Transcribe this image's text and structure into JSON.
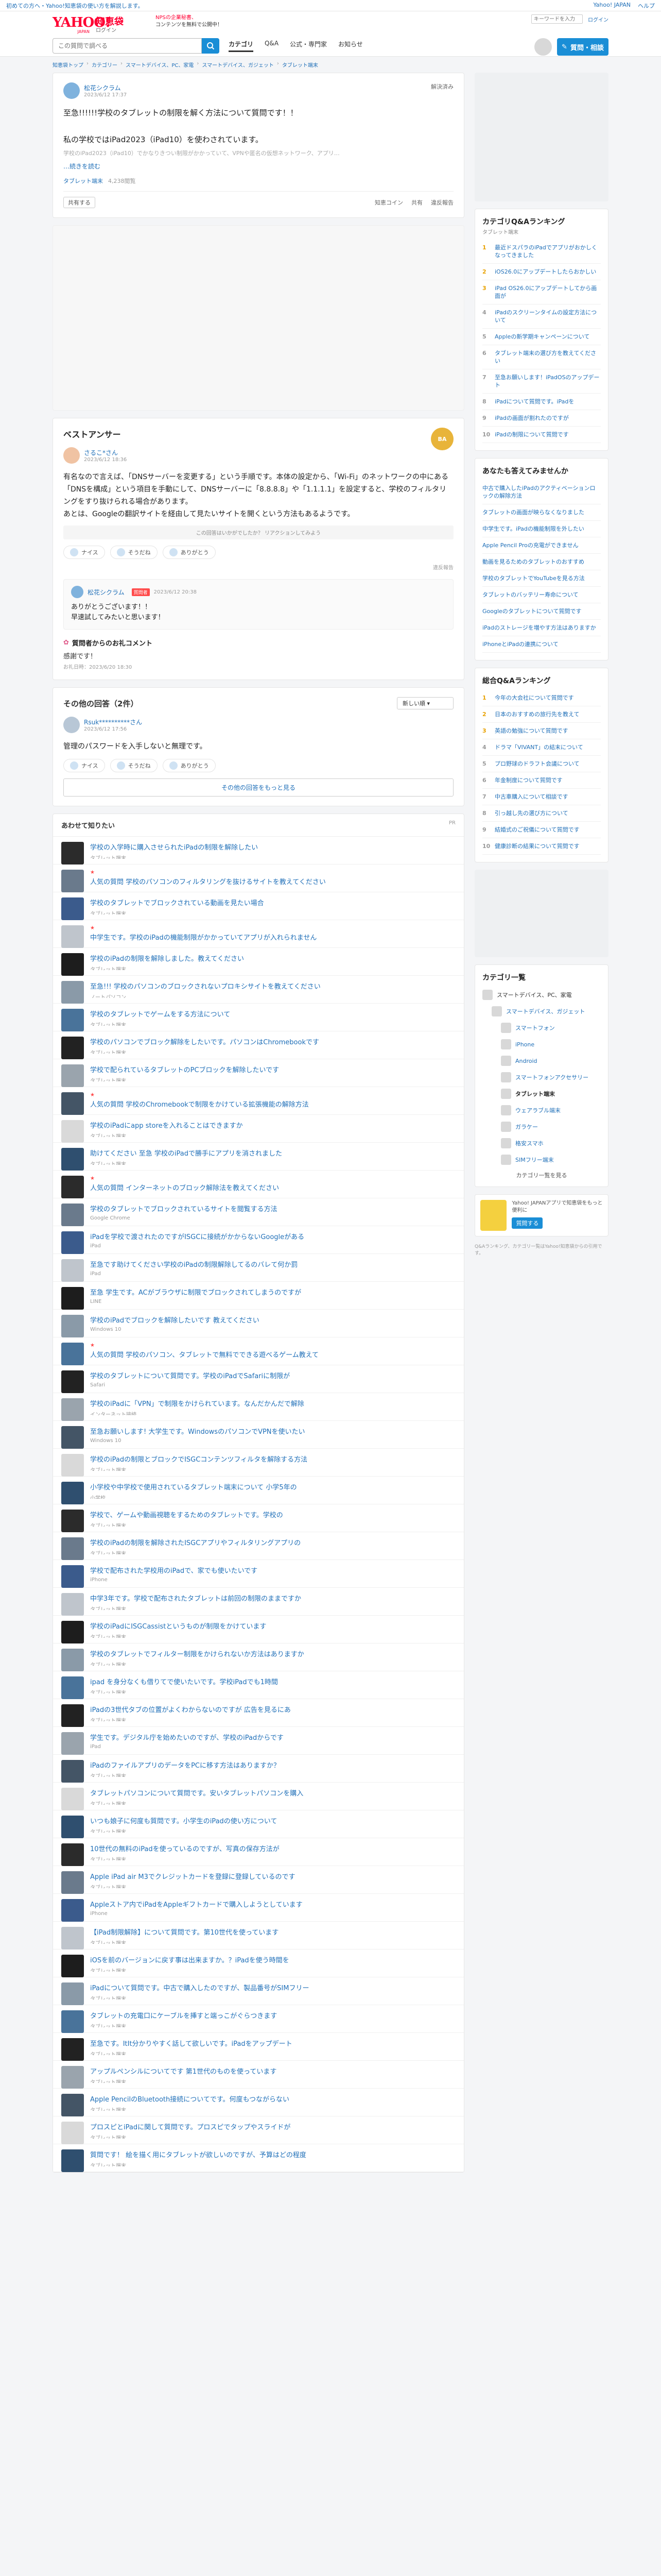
{
  "topline": {
    "left": "初めての方へ・Yahoo!知恵袋の使い方を解説します。",
    "links": [
      "Yahoo! JAPAN",
      "ヘルプ"
    ]
  },
  "header": {
    "logo": "YAHOO!",
    "logo_sub": "JAPAN",
    "brand": "知恵袋",
    "brand_sub": "ログイン",
    "promo_1": "NPSの企業秘書、",
    "promo_2": "コンテンツを無料で公開中！",
    "mini_search": "キーワードを入力",
    "login": "ログイン",
    "search_placeholder": "この質問で調べる",
    "nav": [
      "カテゴリ",
      "Q&A",
      "公式・専門家",
      "お知らせ"
    ],
    "ask_label": "質問・相談"
  },
  "breadcrumbs": [
    "知恵袋トップ",
    "カテゴリー",
    "スマートデバイス、PC、家電",
    "スマートデバイス、ガジェット",
    "タブレット端末"
  ],
  "question": {
    "user": "松花シクラム",
    "date": "2023/6/12 17:37",
    "status": "解決済み",
    "text": "至急!!!!!!学校のタブレットの制限を解く方法について質問です！！\n\n私の学校ではiPad2023（iPad10）を使わされています。",
    "hint": "学校のiPad2023（iPad10）でかなりきつい制限がかかっていて、VPNや匿名の仮想ネットワーク、アプリ…",
    "more": "…続きを読む",
    "tags": [
      "タブレット端末",
      "4,238閲覧"
    ],
    "share_label": "共有する",
    "actions": [
      "知恵コイン",
      "共有",
      "違反報告"
    ]
  },
  "best": {
    "title": "ベストアンサー",
    "medal": "BA",
    "user": "さるこ*さん",
    "date": "2023/6/12 18:36",
    "text": "有名なので言えば、「DNSサーバーを変更する」という手順です。本体の設定から、「Wi-Fi」のネットワークの中にある「DNSを構成」という項目を手動にして、DNSサーバーに「8.8.8.8」や「1.1.1.1」を設定すると、学校のフィルタリングをすり抜けられる場合があります。\nあとは、Googleの翻訳サイトを経由して見たいサイトを開くという方法もあるようです。",
    "notice": "この回答はいかがでしたか？ リアクションしてみよう",
    "reactions": [
      "ナイス",
      "そうだね",
      "ありがとう"
    ],
    "report": "違反報告",
    "reply_user": "松花シクラム",
    "reply_tag": "質問者",
    "reply_date": "2023/6/12 20:38",
    "reply_text": "ありがとうございます！！\n早速試してみたいと思います！",
    "thanks_title": "質問者からのお礼コメント",
    "thanks_text": "感謝です！",
    "thanks_date": "お礼日時：2023/6/20 18:30"
  },
  "others": {
    "title": "その他の回答（2件）",
    "sort": "新しい順",
    "user": "Rsuk**********さん",
    "date": "2023/6/12 17:56",
    "text": "管理のパスワードを入手しないと無理です。",
    "reactions": [
      "ナイス",
      "そうだね",
      "ありがとう"
    ],
    "more": "その他の回答をもっと見る"
  },
  "rec": {
    "title": "あわせて知りたい",
    "pr": "PR",
    "items": [
      {
        "t": "学校の入学時に購入させられたiPadの制限を解除したい",
        "c": "タブレット端末",
        "pr": false
      },
      {
        "t": "人気の質問 学校のパソコンのフィルタリングを抜けるサイトを教えてください",
        "c": "スマートデバイス、PC、家電",
        "pr": true
      },
      {
        "t": "学校のタブレットでブロックされている動画を見たい場合",
        "c": "タブレット端末",
        "pr": false
      },
      {
        "t": "中学生です。学校のiPadの機能制限がかかっていてアプリが入れられません",
        "c": "タブレット端末",
        "pr": true
      },
      {
        "t": "学校のiPadの制限を解除しました。教えてください",
        "c": "タブレット端末",
        "pr": false
      },
      {
        "t": "至急!!! 学校のパソコンのブロックされないプロキシサイトを教えてください",
        "c": "ノートパソコン",
        "pr": false
      },
      {
        "t": "学校のタブレットでゲームをする方法について",
        "c": "タブレット端末",
        "pr": false
      },
      {
        "t": "学校のパソコンでブロック解除をしたいです。パソコンはChromebookです",
        "c": "タブレット端末",
        "pr": false
      },
      {
        "t": "学校で配られているタブレットのPCブロックを解除したいです",
        "c": "タブレット端末",
        "pr": false
      },
      {
        "t": "人気の質問 学校のChromebookで制限をかけている拡張機能の解除方法",
        "c": "Google Chrome",
        "pr": true
      },
      {
        "t": "学校のiPadにapp storeを入れることはできますか",
        "c": "タブレット端末",
        "pr": false
      },
      {
        "t": "助けてください 至急 学校のiPadで勝手にアプリを消されました",
        "c": "タブレット端末",
        "pr": false
      },
      {
        "t": "人気の質問 インターネットのブロック解除法を教えてください",
        "c": "インターネットサービス",
        "pr": true
      },
      {
        "t": "学校のタブレットでブロックされているサイトを閲覧する方法",
        "c": "Google Chrome",
        "pr": false
      },
      {
        "t": "iPadを学校で渡されたのですがISGCに接続がかからないGoogleがある",
        "c": "iPad",
        "pr": false
      },
      {
        "t": "至急です助けてください学校のiPadの制限解除してるのバレて何か罰",
        "c": "iPad",
        "pr": false
      },
      {
        "t": "至急 学生です。ACがブラウザに制限でブロックされてしまうのですが",
        "c": "LINE",
        "pr": false
      },
      {
        "t": "学校のiPadでブロックを解除したいです 教えてください",
        "c": "Windows 10",
        "pr": false
      },
      {
        "t": "人気の質問 学校のパソコン、タブレットで無料でできる遊べるゲーム教えて",
        "c": "タブレット端末",
        "pr": true
      },
      {
        "t": "学校のタブレットについて質問です。学校のiPadでSafariに制限が",
        "c": "Safari",
        "pr": false
      },
      {
        "t": "学校のiPadに「VPN」で制限をかけられています。なんだかんだで解除",
        "c": "インターネット接続",
        "pr": false
      },
      {
        "t": "至急お願いします! 大学生です。WindowsのパソコンでVPNを使いたい",
        "c": "Windows 10",
        "pr": false
      },
      {
        "t": "学校のiPadの制限とブロックでISGCコンテンツフィルタを解除する方法",
        "c": "タブレット端末",
        "pr": false
      },
      {
        "t": "小学校や中学校で使用されているタブレット端末について 小学5年の",
        "c": "小学校",
        "pr": false
      },
      {
        "t": "学校で、ゲームや動画視聴をするためのタブレットです。学校の",
        "c": "タブレット端末",
        "pr": false
      },
      {
        "t": "学校のiPadの制限を解除されたISGCアプリやフィルタリングアプリの",
        "c": "タブレット端末",
        "pr": false
      },
      {
        "t": "学校で配布された学校用のiPadで、家でも使いたいです",
        "c": "iPhone",
        "pr": false
      },
      {
        "t": "中学3年です。学校で配布されたタブレットは前回の制限のままですか",
        "c": "タブレット端末",
        "pr": false
      },
      {
        "t": "学校のiPadにISGCassistというものが制限をかけています",
        "c": "タブレット端末",
        "pr": false
      },
      {
        "t": "学校のタブレットでフィルター制限をかけられないか方法はありますか",
        "c": "タブレット端末",
        "pr": false
      },
      {
        "t": "ipad を身分なくも借りてで使いたいです。学校iPadでも1時間",
        "c": "タブレット端末",
        "pr": false
      },
      {
        "t": "iPadの3世代タブの位置がよくわからないのですが 広告を見るにあ",
        "c": "タブレット端末",
        "pr": false
      },
      {
        "t": "学生です。デジタル庁を始めたいのですが、学校のiPadからです",
        "c": "iPad",
        "pr": false
      },
      {
        "t": "iPadのファイルアプリのデータをPCに移す方法はありますか？",
        "c": "タブレット端末",
        "pr": false
      },
      {
        "t": "タブレットパソコンについて質問です。安いタブレットパソコンを購入",
        "c": "タブレット端末",
        "pr": false
      },
      {
        "t": "いつも娘子に何度も質問です。小学生のiPadの使い方について",
        "c": "タブレット端末",
        "pr": false
      },
      {
        "t": "10世代の無料のiPadを使っているのですが、写真の保存方法が",
        "c": "タブレット端末",
        "pr": false
      },
      {
        "t": "Apple iPad air M3でクレジットカードを登録に登録しているのです",
        "c": "タブレット端末",
        "pr": false
      },
      {
        "t": "Appleストア内でiPadをAppleギフトカードで購入しようとしています",
        "c": "iPhone",
        "pr": false
      },
      {
        "t": "【iPad制限解除】について質問です。第10世代を使っています",
        "c": "タブレット端末",
        "pr": false
      },
      {
        "t": "iOSを前のバージョンに戻す事は出来ますか。？iPadを使う時間を",
        "c": "タブレット端末",
        "pr": false
      },
      {
        "t": "iPadについて質問です。中古で購入したのですが、製品番号がSIMフリー",
        "c": "タブレット端末",
        "pr": false
      },
      {
        "t": "タブレットの充電口にケーブルを挿すと端っこがぐらつきます",
        "c": "タブレット端末",
        "pr": false
      },
      {
        "t": "至急です。ItIt分かりやすく話して欲しいです。iPadをアップデート",
        "c": "タブレット端末",
        "pr": false
      },
      {
        "t": "アップルペンシルについてです 第1世代のものを使っています",
        "c": "タブレット端末",
        "pr": false
      },
      {
        "t": "Apple PencilのBluetooth接続についてです。何度もつながらない",
        "c": "タブレット端末",
        "pr": false
      },
      {
        "t": "プロスピとiPadに関して質問です。プロスピでタップやスライドが",
        "c": "タブレット端末",
        "pr": false
      },
      {
        "t": "質問です！ 絵を描く用にタブレットが欲しいのですが、予算はどの程度",
        "c": "タブレット端末",
        "pr": false
      }
    ]
  },
  "side": {
    "rank_title": "カテゴリQ&Aランキング",
    "rank_sub": "タブレット端末",
    "ranks": [
      "最近ドスパラのiPadでアプリがおかしくなってきました",
      "iOS26.0にアップデートしたらおかしい",
      "iPad OS26.0にアップデートしてから画面が",
      "iPadのスクリーンタイムの設定方法について",
      "Appleの新学期キャンペーンについて",
      "タブレット端末の選び方を教えてください",
      "至急お願いします！iPadOSのアップデート",
      "iPadについて質問です。iPadを",
      "iPadの画面が割れたのですが",
      "iPadの制限について質問です"
    ],
    "recent_title": "あなたも答えてみませんか",
    "recent": [
      "中古で購入したiPadのアクティベーションロックの解除方法",
      "タブレットの画面が映らなくなりました",
      "中学生です。iPadの機能制限を外したい",
      "Apple Pencil Proの充電ができません",
      "動画を見るためのタブレットのおすすめ",
      "学校のタブレットでYouTubeを見る方法",
      "タブレットのバッテリー寿命について",
      "Googleのタブレットについて質問です",
      "iPadのストレージを増やす方法はありますか",
      "iPhoneとiPadの連携について"
    ],
    "total_title": "総合Q&Aランキング",
    "total": [
      "今年の大会社について質問です",
      "日本のおすすめの旅行先を教えて",
      "英語の勉強について質問です",
      "ドラマ「VIVANT」の結末について",
      "プロ野球のドラフト会議について",
      "年金制度について質問です",
      "中古車購入について相談です",
      "引っ越し先の選び方について",
      "結婚式のご祝儀について質問です",
      "健康診断の結果について質問です"
    ],
    "cat_title": "カテゴリ一覧",
    "cats": [
      {
        "n": "スマートデバイス、PC、家電",
        "l": 0
      },
      {
        "n": "スマートデバイス、ガジェット",
        "l": 1
      },
      {
        "n": "スマートフォン",
        "l": 2
      },
      {
        "n": "iPhone",
        "l": 2
      },
      {
        "n": "Android",
        "l": 2
      },
      {
        "n": "スマートフォンアクセサリー",
        "l": 2
      },
      {
        "n": "タブレット端末",
        "l": 2
      },
      {
        "n": "ウェアラブル端末",
        "l": 2
      },
      {
        "n": "ガラケー",
        "l": 2
      },
      {
        "n": "格安スマホ",
        "l": 2
      },
      {
        "n": "SIMフリー端末",
        "l": 2
      }
    ],
    "cat_more": "カテゴリ一覧を見る",
    "banner_text": "Yahoo! JAPANアプリで知恵袋をもっと便利に",
    "banner_btn": "質問する",
    "footnote": "Q&Aランキング、カテゴリ一覧はYahoo!知恵袋からの引用です。"
  }
}
